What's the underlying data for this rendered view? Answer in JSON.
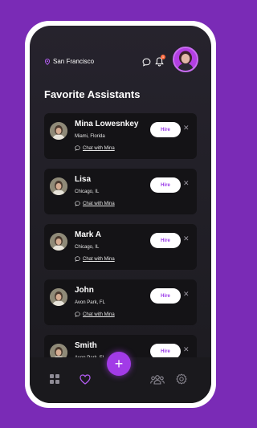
{
  "header": {
    "location": "San Francisco",
    "notification_count": "1"
  },
  "page_title": "Favorite Assistants",
  "assistants": [
    {
      "name": "Mina Lowesnkey",
      "city": "Miami, Florida",
      "chat_label": "Chat with Mina",
      "hire_label": "Hire"
    },
    {
      "name": "Lisa",
      "city": "Chicago, IL",
      "chat_label": "Chat with Mina",
      "hire_label": "Hire"
    },
    {
      "name": "Mark A",
      "city": "Chicago, IL",
      "chat_label": "Chat with Mina",
      "hire_label": "Hire"
    },
    {
      "name": "John",
      "city": "Avon Park, FL",
      "chat_label": "Chat with Mina",
      "hire_label": "Hire"
    },
    {
      "name": "Smith",
      "city": "Avon Park, FL",
      "chat_label": "",
      "hire_label": "Hire"
    }
  ],
  "nav": {
    "fab_label": "+",
    "items": [
      "dashboard-icon",
      "heart-icon",
      "add-icon",
      "team-icon",
      "settings-icon"
    ]
  },
  "colors": {
    "accent": "#a23be7",
    "background": "#7a2bb6",
    "card": "#141316"
  }
}
